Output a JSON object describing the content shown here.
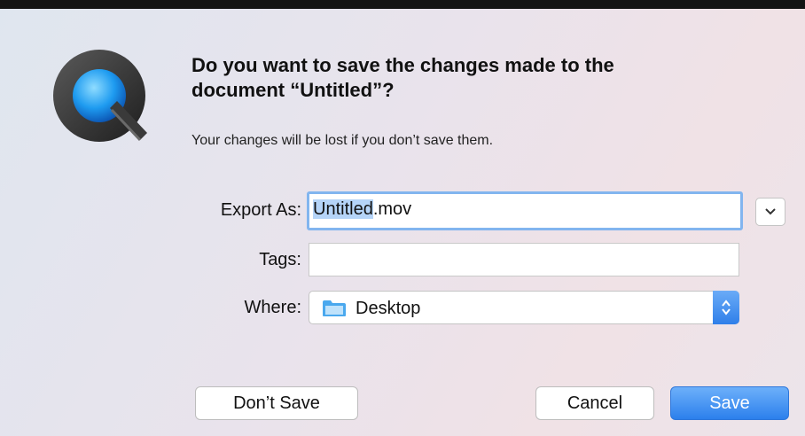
{
  "dialog": {
    "heading_line1": "Do you want to save the changes made to the",
    "heading_line2": "document “Untitled”?",
    "subtext": "Your changes will be lost if you don’t save them."
  },
  "form": {
    "export_label": "Export As:",
    "filename_selected": "Untitled",
    "filename_ext": ".mov",
    "tags_label": "Tags:",
    "tags_value": "",
    "where_label": "Where:",
    "where_value": "Desktop"
  },
  "buttons": {
    "dont_save": "Don’t Save",
    "cancel": "Cancel",
    "save": "Save"
  },
  "icons": {
    "app": "quicktime-icon",
    "disclosure": "chevron-down-icon",
    "folder": "folder-icon",
    "stepper": "up-down-arrows-icon"
  },
  "colors": {
    "accent": "#2c80ec",
    "selection": "#b5d4f8",
    "focus_ring": "#82b5ef"
  }
}
